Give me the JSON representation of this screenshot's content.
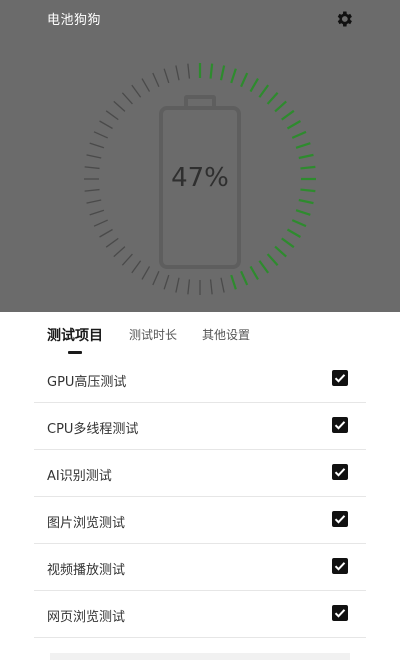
{
  "app": {
    "title": "电池狗狗",
    "settings_icon": "gear-icon",
    "battery_percent_text": "47%",
    "battery_level": 0.47,
    "colors": {
      "hero_bg": "#6b6b6b",
      "tick_active": "#2e8b2e",
      "tick_inactive": "#4a4a4a",
      "checkbox": "#111111"
    }
  },
  "tabs": [
    {
      "label": "测试项目",
      "active": true
    },
    {
      "label": "测试时长",
      "active": false
    },
    {
      "label": "其他设置",
      "active": false
    }
  ],
  "tests": [
    {
      "label": "GPU高压测试",
      "checked": true
    },
    {
      "label": "CPU多线程测试",
      "checked": true
    },
    {
      "label": "AI识别测试",
      "checked": true
    },
    {
      "label": "图片浏览测试",
      "checked": true
    },
    {
      "label": "视频播放测试",
      "checked": true
    },
    {
      "label": "网页浏览测试",
      "checked": true
    }
  ]
}
